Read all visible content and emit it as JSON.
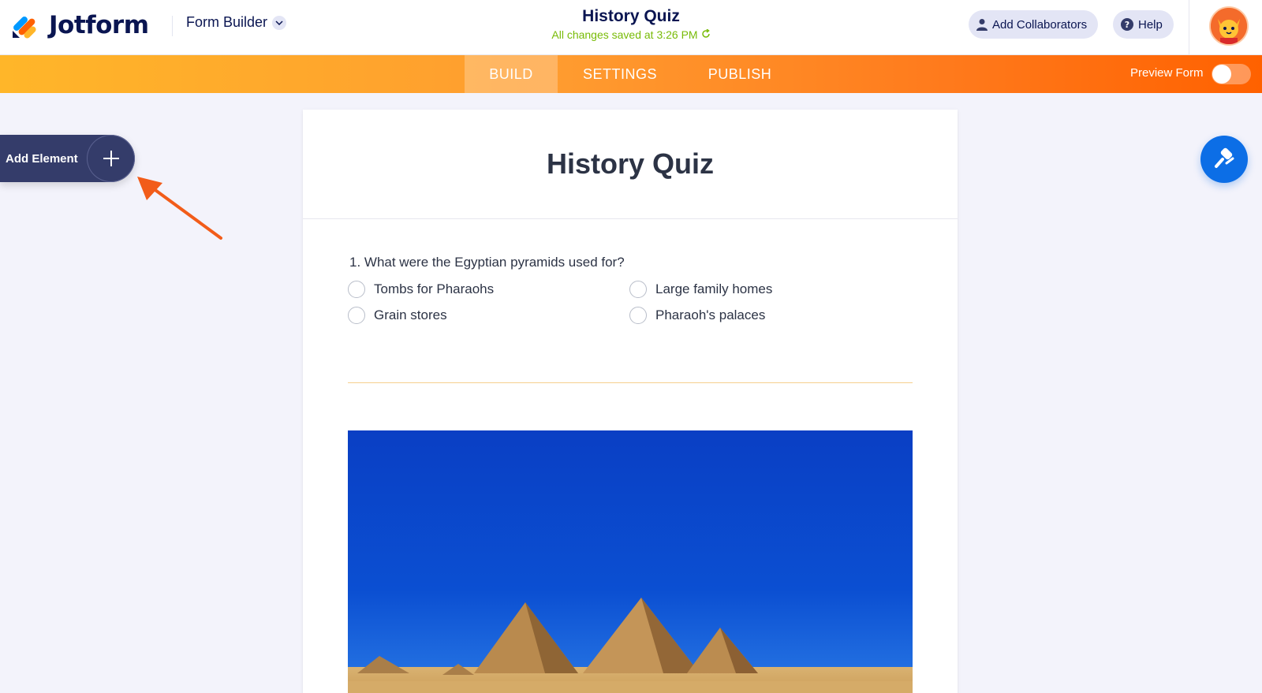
{
  "app": {
    "brand": "Jotform",
    "mode_label": "Form Builder"
  },
  "header": {
    "form_title": "History Quiz",
    "save_status": "All changes saved at 3:26 PM",
    "add_collaborators": "Add Collaborators",
    "help": "Help"
  },
  "nav": {
    "tabs": [
      {
        "label": "BUILD",
        "active": true
      },
      {
        "label": "SETTINGS",
        "active": false
      },
      {
        "label": "PUBLISH",
        "active": false
      }
    ],
    "preview_label": "Preview Form",
    "preview_on": false
  },
  "sidebar": {
    "add_element": "Add Element"
  },
  "form": {
    "title": "History Quiz",
    "question": "1. What were the Egyptian pyramids used for?",
    "options": [
      "Tombs for Pharaohs",
      "Large family homes",
      "Grain stores",
      "Pharaoh's palaces"
    ]
  },
  "colors": {
    "accent_orange": "#ff6100",
    "navy": "#0a1551",
    "saved_green": "#78bb07",
    "designer_blue": "#0c6ee6"
  },
  "icons": {
    "plus": "plus-icon",
    "designer": "paint-roller-icon",
    "help": "question-circle-icon",
    "collaborator": "user-icon"
  }
}
